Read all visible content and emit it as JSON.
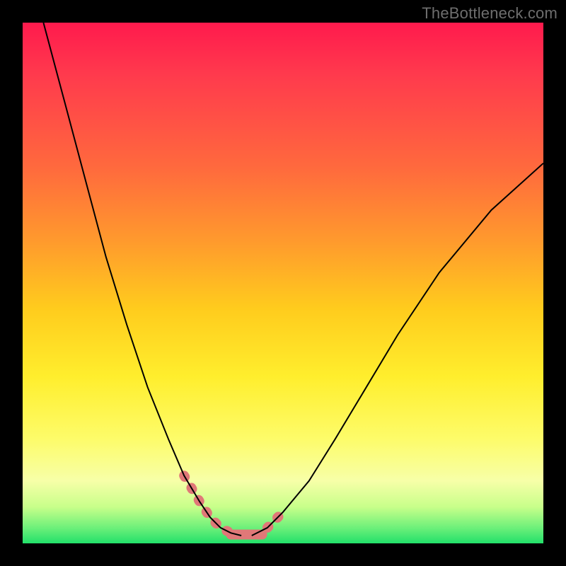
{
  "watermark": "TheBottleneck.com",
  "chart_data": {
    "type": "line",
    "title": "",
    "xlabel": "",
    "ylabel": "",
    "xlim": [
      0,
      100
    ],
    "ylim": [
      0,
      100
    ],
    "grid": false,
    "legend": false,
    "note": "Axis values are estimates; no tick labels are visible in the image. Curves traced approximately from pixel positions.",
    "series": [
      {
        "name": "left-curve",
        "x": [
          4,
          8,
          12,
          16,
          20,
          24,
          28,
          31,
          34,
          36,
          38,
          40,
          42
        ],
        "y": [
          100,
          85,
          70,
          55,
          42,
          30,
          20,
          13,
          8,
          5,
          3,
          2,
          1.5
        ]
      },
      {
        "name": "right-curve",
        "x": [
          44,
          47,
          50,
          55,
          60,
          66,
          72,
          80,
          90,
          100
        ],
        "y": [
          1.5,
          3,
          6,
          12,
          20,
          30,
          40,
          52,
          64,
          73
        ]
      }
    ],
    "confidence_band": {
      "name": "salmon-band-near-minimum",
      "left_segment_x": [
        31,
        40
      ],
      "flat_segment_x": [
        40,
        46
      ],
      "right_segment_x": [
        46,
        52
      ],
      "approx_y": [
        13,
        1.5,
        1.5,
        8
      ]
    },
    "colors": {
      "curve": "#000000",
      "band": "#e07878",
      "gradient_top": "#ff1a4d",
      "gradient_mid": "#ffee2d",
      "gradient_bottom": "#22e06a",
      "frame": "#000000",
      "watermark": "#6e6e6e"
    }
  }
}
